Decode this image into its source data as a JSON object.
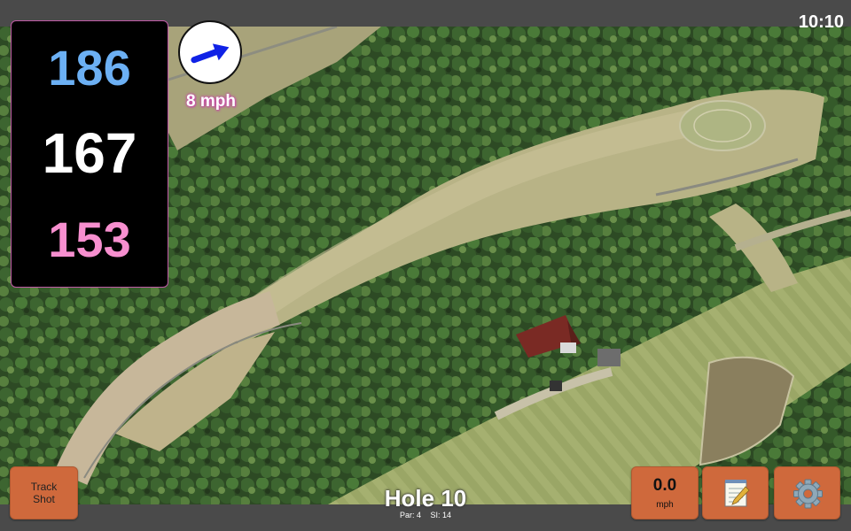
{
  "status": {
    "time": "10:10"
  },
  "distances": {
    "back": "186",
    "middle": "167",
    "front": "153",
    "back_color": "#6cb0f4",
    "middle_color": "#ffffff",
    "front_color": "#f78fcf"
  },
  "wind": {
    "speed_label": "8 mph",
    "arrow_color": "#1022e6",
    "icon": "wind-direction-arrow"
  },
  "track_shot": {
    "label_line1": "Track",
    "label_line2": "Shot"
  },
  "hole": {
    "title": "Hole 10",
    "par_label": "Par: 4",
    "si_label": "SI: 14"
  },
  "speed": {
    "value": "0.0",
    "unit": "mph"
  },
  "notes_button": {
    "icon": "notepad-icon"
  },
  "settings_button": {
    "icon": "gear-icon"
  },
  "colors": {
    "button": "#cf693c",
    "bar": "#4a4a4a"
  }
}
